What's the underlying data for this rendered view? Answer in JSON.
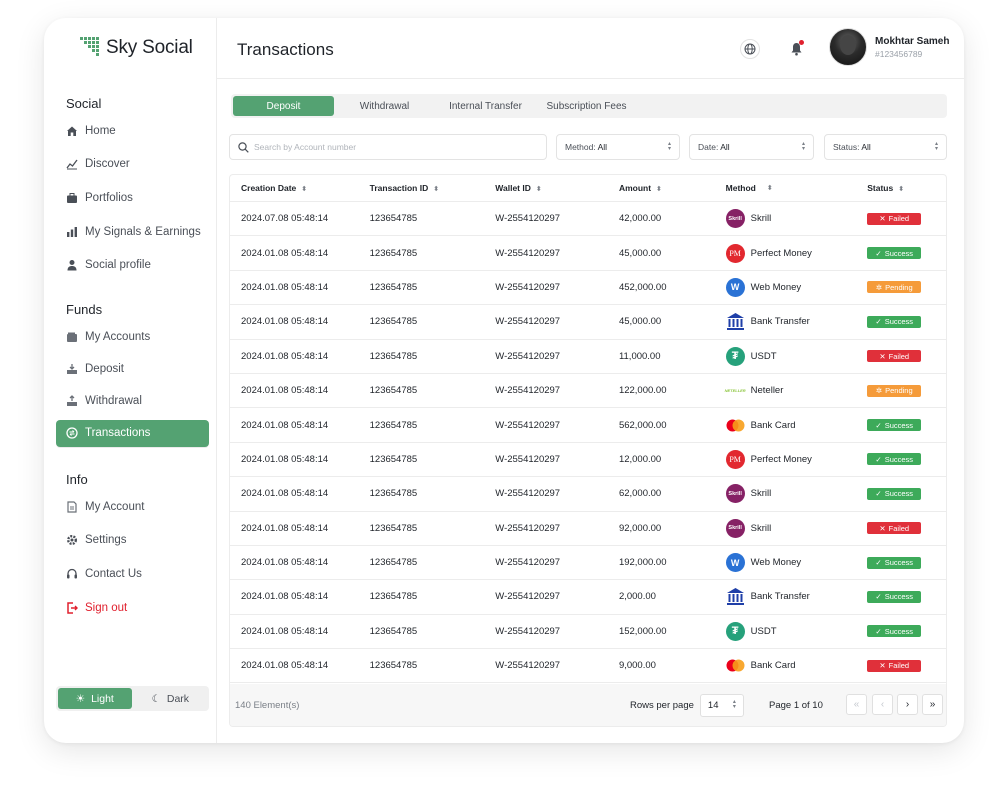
{
  "app": {
    "name": "Sky Social",
    "brand_color": "#54a272"
  },
  "sidebar": {
    "social_title": "Social",
    "social_items": [
      {
        "label": "Home",
        "icon": "home-icon"
      },
      {
        "label": "Discover",
        "icon": "chart-line-icon"
      },
      {
        "label": "Portfolios",
        "icon": "briefcase-icon"
      },
      {
        "label": "My Signals & Earnings",
        "icon": "bar-chart-icon"
      },
      {
        "label": "Social profile",
        "icon": "user-icon"
      }
    ],
    "funds_title": "Funds",
    "funds_items": [
      {
        "label": "My Accounts",
        "icon": "wallet-icon"
      },
      {
        "label": "Deposit",
        "icon": "deposit-icon"
      },
      {
        "label": "Withdrawal",
        "icon": "withdraw-icon"
      },
      {
        "label": "Transactions",
        "icon": "transactions-icon",
        "active": true
      }
    ],
    "info_title": "Info",
    "info_items": [
      {
        "label": "My Account",
        "icon": "document-icon"
      },
      {
        "label": "Settings",
        "icon": "gear-icon"
      },
      {
        "label": "Contact Us",
        "icon": "headset-icon"
      },
      {
        "label": "Sign out",
        "icon": "signout-icon"
      }
    ],
    "theme": {
      "light": "Light",
      "dark": "Dark",
      "selected": "Light"
    }
  },
  "header": {
    "title": "Transactions",
    "user": {
      "name": "Mokhtar Sameh",
      "id": "#123456789"
    }
  },
  "tabs": [
    {
      "label": "Deposit",
      "active": true
    },
    {
      "label": "Withdrawal"
    },
    {
      "label": "Internal Transfer"
    },
    {
      "label": "Subscription Fees"
    }
  ],
  "filters": {
    "search_placeholder": "Search by  Account number",
    "method": {
      "label": "Method:",
      "value": "All"
    },
    "date": {
      "label": "Date:",
      "value": "All"
    },
    "status": {
      "label": "Status:",
      "value": "All"
    }
  },
  "table": {
    "columns": [
      "Creation Date",
      "Transaction ID",
      "Wallet ID",
      "Amount",
      "Method",
      "Status"
    ],
    "rows": [
      {
        "date": "2024.07.08 05:48:14",
        "tid": "123654785",
        "wallet": "W-2554120297",
        "amount": "42,000.00",
        "method": "Skrill",
        "status": "Failed"
      },
      {
        "date": "2024.01.08 05:48:14",
        "tid": "123654785",
        "wallet": "W-2554120297",
        "amount": "45,000.00",
        "method": "Perfect Money",
        "status": "Success"
      },
      {
        "date": "2024.01.08 05:48:14",
        "tid": "123654785",
        "wallet": "W-2554120297",
        "amount": "452,000.00",
        "method": "Web Money",
        "status": "Pending"
      },
      {
        "date": "2024.01.08 05:48:14",
        "tid": "123654785",
        "wallet": "W-2554120297",
        "amount": "45,000.00",
        "method": "Bank Transfer",
        "status": "Success"
      },
      {
        "date": "2024.01.08 05:48:14",
        "tid": "123654785",
        "wallet": "W-2554120297",
        "amount": "11,000.00",
        "method": "USDT",
        "status": "Failed"
      },
      {
        "date": "2024.01.08 05:48:14",
        "tid": "123654785",
        "wallet": "W-2554120297",
        "amount": "122,000.00",
        "method": "Neteller",
        "status": "Pending"
      },
      {
        "date": "2024.01.08 05:48:14",
        "tid": "123654785",
        "wallet": "W-2554120297",
        "amount": "562,000.00",
        "method": "Bank Card",
        "status": "Success"
      },
      {
        "date": "2024.01.08 05:48:14",
        "tid": "123654785",
        "wallet": "W-2554120297",
        "amount": "12,000.00",
        "method": "Perfect Money",
        "status": "Success"
      },
      {
        "date": "2024.01.08 05:48:14",
        "tid": "123654785",
        "wallet": "W-2554120297",
        "amount": "62,000.00",
        "method": "Skrill",
        "status": "Success"
      },
      {
        "date": "2024.01.08 05:48:14",
        "tid": "123654785",
        "wallet": "W-2554120297",
        "amount": "92,000.00",
        "method": "Skrill",
        "status": "Failed"
      },
      {
        "date": "2024.01.08 05:48:14",
        "tid": "123654785",
        "wallet": "W-2554120297",
        "amount": "192,000.00",
        "method": "Web Money",
        "status": "Success"
      },
      {
        "date": "2024.01.08 05:48:14",
        "tid": "123654785",
        "wallet": "W-2554120297",
        "amount": "2,000.00",
        "method": "Bank Transfer",
        "status": "Success"
      },
      {
        "date": "2024.01.08 05:48:14",
        "tid": "123654785",
        "wallet": "W-2554120297",
        "amount": "152,000.00",
        "method": "USDT",
        "status": "Success"
      },
      {
        "date": "2024.01.08 05:48:14",
        "tid": "123654785",
        "wallet": "W-2554120297",
        "amount": "9,000.00",
        "method": "Bank Card",
        "status": "Failed"
      }
    ],
    "footer": {
      "count": "140 Element(s)",
      "rows_per_page_label": "Rows per page",
      "rows_per_page": "14",
      "page_info": "Page 1 of 10"
    }
  },
  "method_icons": {
    "Skrill": {
      "icon": "skrill-icon",
      "color": "#862165",
      "text": "Skrill"
    },
    "Perfect Money": {
      "icon": "perfect-money-icon",
      "color": "#e2282f",
      "text": "PM"
    },
    "Web Money": {
      "icon": "webmoney-icon",
      "color": "#2a72d5",
      "text": "W"
    },
    "Bank Transfer": {
      "icon": "bank-icon",
      "color": "#1f3fa8",
      "text": ""
    },
    "USDT": {
      "icon": "tether-icon",
      "color": "#26a17b",
      "text": "₮"
    },
    "Neteller": {
      "icon": "neteller-icon",
      "color": "#8dc63f",
      "text": "NETELLER"
    },
    "Bank Card": {
      "icon": "mastercard-icon",
      "color": "#eb001b",
      "text": ""
    }
  },
  "status_colors": {
    "Failed": "#e0303a",
    "Success": "#3daa5a",
    "Pending": "#f59b3a"
  }
}
